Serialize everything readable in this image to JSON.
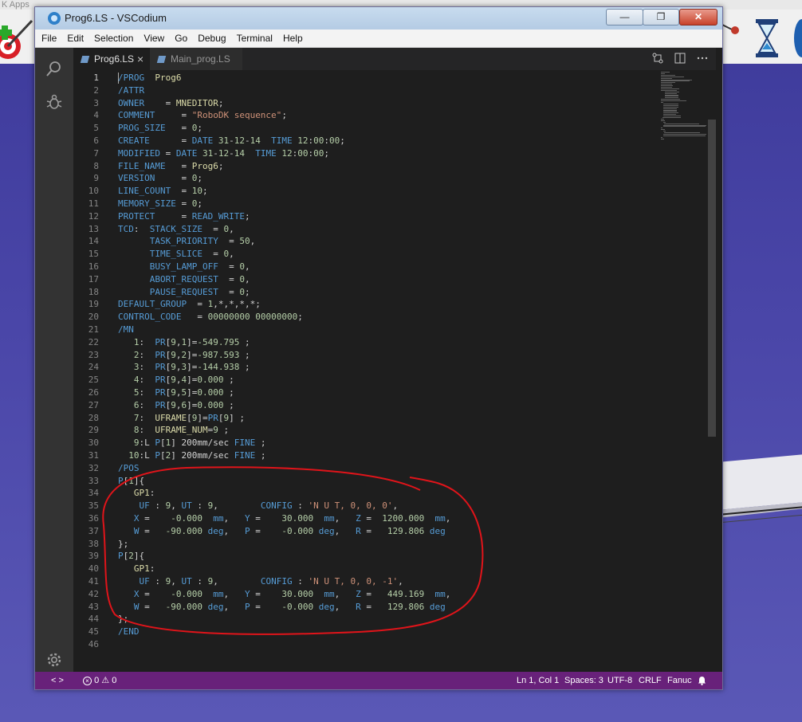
{
  "background": {
    "topstrip_text": "K Apps"
  },
  "window": {
    "title": "Prog6.LS - VSCodium",
    "min_label": "—",
    "max_label": "❐",
    "close_label": "✕"
  },
  "menu": [
    "File",
    "Edit",
    "Selection",
    "View",
    "Go",
    "Debug",
    "Terminal",
    "Help"
  ],
  "activity_icons": [
    "search-icon",
    "debug-icon",
    "gear-icon"
  ],
  "tabs": [
    {
      "label": "Prog6.LS",
      "active": true
    },
    {
      "label": "Main_prog.LS",
      "active": false
    }
  ],
  "tab_actions": [
    "source-control-compare-icon",
    "split-editor-icon",
    "more-actions-icon"
  ],
  "lines": [
    "/PROG  Prog6",
    "/ATTR",
    "OWNER    = MNEDITOR;",
    "COMMENT     = \"RoboDK sequence\";",
    "PROG_SIZE   = 0;",
    "CREATE      = DATE 31-12-14  TIME 12:00:00;",
    "MODIFIED = DATE 31-12-14  TIME 12:00:00;",
    "FILE_NAME   = Prog6;",
    "VERSION     = 0;",
    "LINE_COUNT  = 10;",
    "MEMORY_SIZE = 0;",
    "PROTECT     = READ_WRITE;",
    "TCD:  STACK_SIZE  = 0,",
    "      TASK_PRIORITY  = 50,",
    "      TIME_SLICE  = 0,",
    "      BUSY_LAMP_OFF  = 0,",
    "      ABORT_REQUEST  = 0,",
    "      PAUSE_REQUEST  = 0;",
    "DEFAULT_GROUP  = 1,*,*,*,*;",
    "CONTROL_CODE   = 00000000 00000000;",
    "/MN",
    "   1:  PR[9,1]=-549.795 ;",
    "   2:  PR[9,2]=-987.593 ;",
    "   3:  PR[9,3]=-144.938 ;",
    "   4:  PR[9,4]=0.000 ;",
    "   5:  PR[9,5]=0.000 ;",
    "   6:  PR[9,6]=0.000 ;",
    "   7:  UFRAME[9]=PR[9] ;",
    "   8:  UFRAME_NUM=9 ;",
    "   9:L P[1] 200mm/sec FINE ;",
    "  10:L P[2] 200mm/sec FINE ;",
    "/POS",
    "P[1]{",
    "   GP1:",
    "    UF : 9, UT : 9,        CONFIG : 'N U T, 0, 0, 0',",
    "   X =    -0.000  mm,   Y =    30.000  mm,   Z =  1200.000  mm,",
    "   W =   -90.000 deg,   P =    -0.000 deg,   R =   129.806 deg",
    "};",
    "P[2]{",
    "   GP1:",
    "    UF : 9, UT : 9,        CONFIG : 'N U T, 0, 0, -1',",
    "   X =    -0.000  mm,   Y =    30.000  mm,   Z =   449.169  mm,",
    "   W =   -90.000 deg,   P =    -0.000 deg,   R =   129.806 deg",
    "};",
    "/END",
    ""
  ],
  "status": {
    "nav": "< >",
    "errors": "0",
    "warnings": "0",
    "position": "Ln 1, Col 1",
    "spaces": "Spaces: 3",
    "encoding": "UTF-8",
    "eol": "CRLF",
    "language": "Fanuc"
  },
  "colors": {
    "statusbar": "#68217a",
    "annotation": "#e0141a",
    "keyword": "#569cd6",
    "string": "#ce9178",
    "number": "#b5cea8",
    "identifier": "#dcdcaa"
  }
}
